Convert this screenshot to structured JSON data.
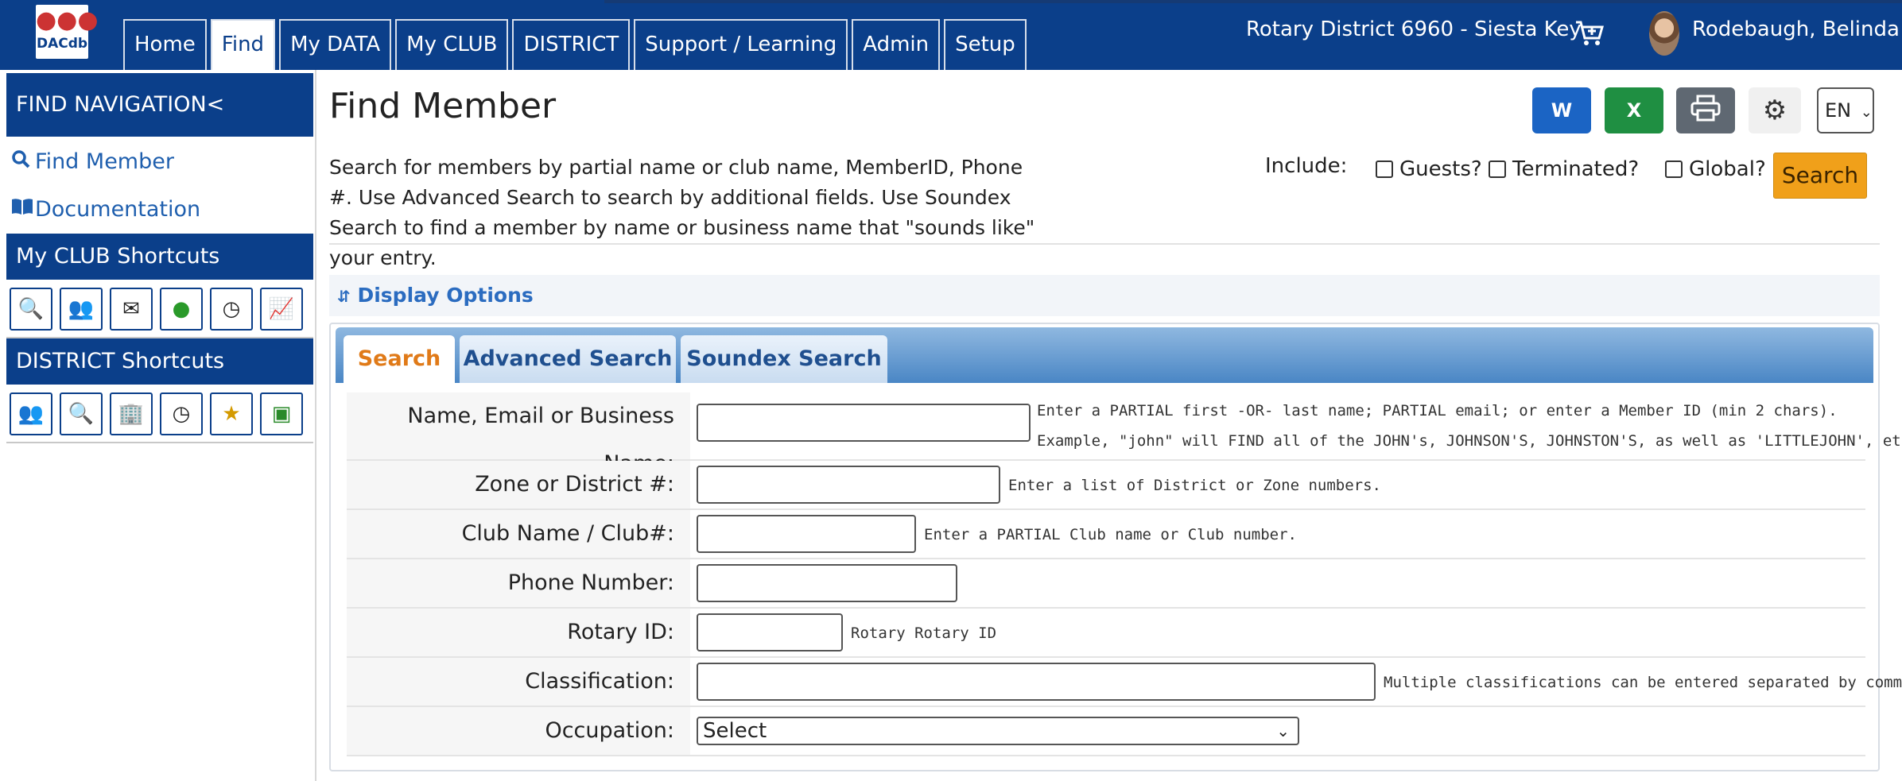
{
  "logo": {
    "text": "DACdb"
  },
  "nav": {
    "tabs": [
      {
        "label": "Home"
      },
      {
        "label": "Find"
      },
      {
        "label": "My DATA"
      },
      {
        "label": "My CLUB"
      },
      {
        "label": "DISTRICT"
      },
      {
        "label": "Support / Learning"
      },
      {
        "label": "Admin"
      },
      {
        "label": "Setup"
      }
    ],
    "active": "Find"
  },
  "header": {
    "district": "Rotary District 6960 - Siesta Key",
    "user": "Rodebaugh, Belinda"
  },
  "sidebar": {
    "find_nav_title": "FIND NAVIGATION<",
    "links": [
      {
        "label": "Find Member",
        "icon": "search-icon"
      },
      {
        "label": "Documentation",
        "icon": "book-icon"
      }
    ],
    "club_shortcuts_title": "My CLUB Shortcuts",
    "district_shortcuts_title": "DISTRICT Shortcuts"
  },
  "page": {
    "title": "Find Member",
    "description": "Search for members by partial name or club name, MemberID, Phone #. Use Advanced Search to search by additional fields. Use Soundex Search to find a member by name or business name that \"sounds like\" your entry.",
    "export_word": "W",
    "export_excel": "X",
    "language": "EN",
    "include_label": "Include:",
    "checkboxes": [
      {
        "label": "Guests?",
        "checked": false
      },
      {
        "label": "Terminated?",
        "checked": false
      },
      {
        "label": "Global?",
        "checked": false
      }
    ],
    "search_button": "Search",
    "display_options": "Display Options"
  },
  "search_tabs": [
    {
      "label": "Search"
    },
    {
      "label": "Advanced Search"
    },
    {
      "label": "Soundex Search"
    }
  ],
  "form": {
    "name": {
      "label": "Name, Email or Business Name:",
      "value": "",
      "hint1": "Enter a PARTIAL first -OR- last name; PARTIAL email; or enter a Member ID (min 2 chars).",
      "hint2": "Example, \"john\" will FIND all of the JOHN's, JOHNSON'S, JOHNSTON'S, as well as 'LITTLEJOHN', etc.)"
    },
    "zone": {
      "label": "Zone or District #:",
      "value": "",
      "hint": "Enter a list of District or Zone numbers."
    },
    "club": {
      "label": "Club Name / Club#:",
      "value": "",
      "hint": "Enter a PARTIAL Club name or Club number."
    },
    "phone": {
      "label": "Phone Number:",
      "value": ""
    },
    "rotary_id": {
      "label": "Rotary ID:",
      "value": "",
      "hint": "Rotary Rotary ID"
    },
    "classification": {
      "label": "Classification:",
      "value": "",
      "hint": "Multiple classifications can be entered separated by commas"
    },
    "occupation": {
      "label": "Occupation:",
      "selected": "Select"
    }
  },
  "colors": {
    "brand_blue": "#0b3f8a",
    "search_orange": "#f0a01a",
    "active_tab_text": "#e07a18",
    "word_blue": "#1b64c4",
    "excel_green": "#1f8f42"
  }
}
